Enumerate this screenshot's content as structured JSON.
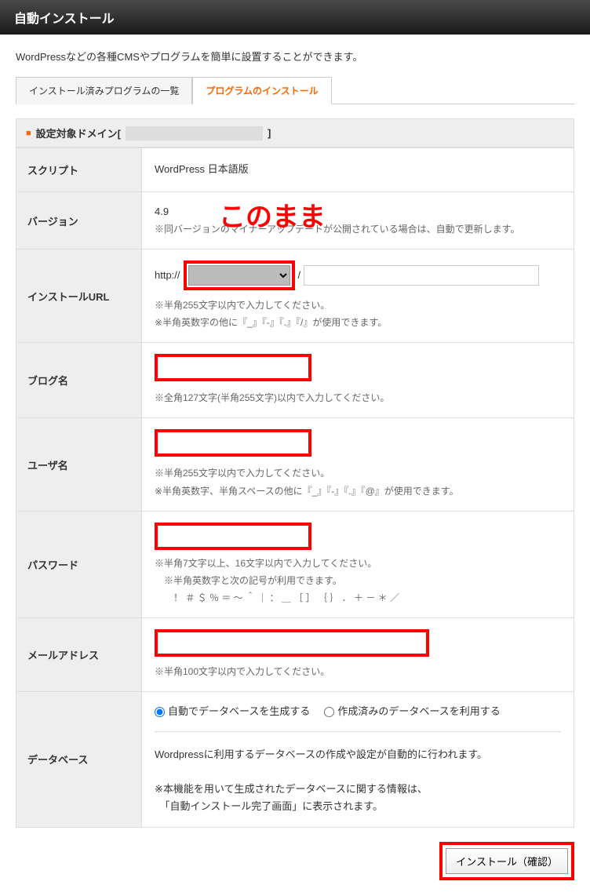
{
  "header": {
    "title": "自動インストール"
  },
  "intro": "WordPressなどの各種CMSやプログラムを簡単に設置することができます。",
  "tabs": {
    "list": "インストール済みプログラムの一覧",
    "install": "プログラムのインストール"
  },
  "domain_bar": {
    "prefix": "設定対象ドメイン[",
    "suffix": "]"
  },
  "rows": {
    "script": {
      "label": "スクリプト",
      "value": "WordPress 日本語版"
    },
    "version": {
      "label": "バージョン",
      "value": "4.9",
      "note": "※同バージョンのマイナーアップデートが公開されている場合は、自動で更新します。"
    },
    "url": {
      "label": "インストールURL",
      "protocol": "http://",
      "slash": "/",
      "note1": "※半角255文字以内で入力してください。",
      "note2": "※半角英数字の他に『_』『-』『.』『/』が使用できます。"
    },
    "blog": {
      "label": "ブログ名",
      "note": "※全角127文字(半角255文字)以内で入力してください。"
    },
    "user": {
      "label": "ユーザ名",
      "note1": "※半角255文字以内で入力してください。",
      "note2": "※半角英数字、半角スペースの他に『_』『-』『.』『@』が使用できます。"
    },
    "password": {
      "label": "パスワード",
      "note1": "※半角7文字以上、16文字以内で入力してください。",
      "note2": "　※半角英数字と次の記号が利用できます。",
      "note3": "　　！ ＃ ＄ ％ ＝ ～ ＾ ｜ ： ＿ ［ ］ ｛ ｝ ． ＋ － ＊ ／"
    },
    "email": {
      "label": "メールアドレス",
      "note": "※半角100文字以内で入力してください。"
    },
    "db": {
      "label": "データベース",
      "radio1": "自動でデータベースを生成する",
      "radio2": "作成済みのデータベースを利用する",
      "desc1": "Wordpressに利用するデータベースの作成や設定が自動的に行われます。",
      "desc2": "※本機能を用いて生成されたデータベースに関する情報は、",
      "desc3": "　「自動インストール完了画面」に表示されます。"
    }
  },
  "annotation": "このまま",
  "submit": "インストール（確認）"
}
